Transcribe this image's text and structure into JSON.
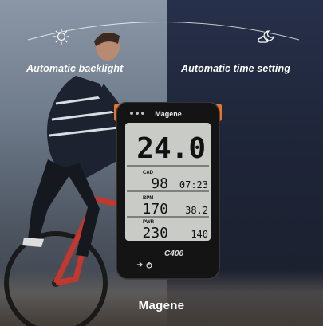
{
  "features": {
    "left_label": "Automatic backlight",
    "right_label": "Automatic time setting"
  },
  "icons": {
    "left": "sun-icon",
    "right": "moon-cloud-icon"
  },
  "device": {
    "header_brand": "Magene",
    "speed": "24.0",
    "cad_label": "CAD",
    "cad_value": "98",
    "side_value_1": "07:23",
    "bpm_label": "BPM",
    "bpm_value": "170",
    "side_value_2": "38.2",
    "pwr_label": "PWR",
    "pwr_value": "230",
    "side_value_3": "140",
    "model": "C406"
  },
  "brand": "Magene",
  "colors": {
    "left_bg": "#7b8796",
    "right_bg": "#1e2538",
    "lcd_bg": "#c9ccc6",
    "accent": "#e8742a"
  }
}
